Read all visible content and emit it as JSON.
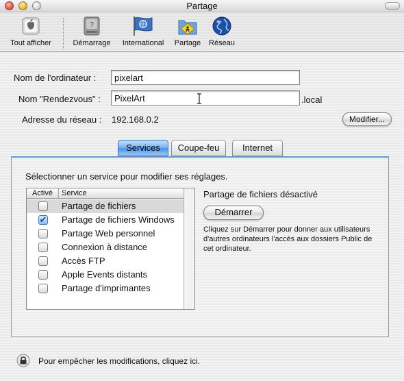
{
  "window": {
    "title": "Partage",
    "colors": {
      "close": "#e05a4c",
      "minimize": "#e9b73c",
      "zoom": "#d4d4d4",
      "accent": "#4f93e5"
    }
  },
  "toolbar": {
    "items": [
      {
        "label": "Tout afficher",
        "icon": "apple-logo-icon"
      },
      {
        "label": "Démarrage",
        "icon": "hard-drive-icon"
      },
      {
        "label": "International",
        "icon": "un-flag-icon"
      },
      {
        "label": "Partage",
        "icon": "shared-folder-icon"
      },
      {
        "label": "Réseau",
        "icon": "globe-icon"
      }
    ]
  },
  "identity": {
    "computer_name_label": "Nom de l'ordinateur :",
    "computer_name_value": "pixelart",
    "rendezvous_label": "Nom \"Rendezvous\" :",
    "rendezvous_value": "PixelArt",
    "rendezvous_suffix": ".local",
    "address_label": "Adresse du réseau :",
    "address_value": "192.168.0.2",
    "modify_button": "Modifier..."
  },
  "tabs": [
    {
      "label": "Services",
      "active": true
    },
    {
      "label": "Coupe-feu",
      "active": false
    },
    {
      "label": "Internet",
      "active": false
    }
  ],
  "services": {
    "instruction": "Sélectionner un service pour modifier ses réglages.",
    "col_active": "Activé",
    "col_service": "Service",
    "items": [
      {
        "name": "Partage de fichiers",
        "checked": false,
        "selected": true
      },
      {
        "name": "Partage de fichiers Windows",
        "checked": true,
        "selected": false
      },
      {
        "name": "Partage Web personnel",
        "checked": false,
        "selected": false
      },
      {
        "name": "Connexion à distance",
        "checked": false,
        "selected": false
      },
      {
        "name": "Accès FTP",
        "checked": false,
        "selected": false
      },
      {
        "name": "Apple Events distants",
        "checked": false,
        "selected": false
      },
      {
        "name": "Partage d'imprimantes",
        "checked": false,
        "selected": false
      }
    ],
    "status_title": "Partage de fichiers désactivé",
    "start_button": "Démarrer",
    "help_text": "Cliquez sur Démarrer pour donner aux utilisateurs d'autres ordinateurs l'accès aux dossiers Public de cet ordinateur."
  },
  "lock": {
    "text": "Pour empêcher les modifications, cliquez ici.",
    "icon": "lock-icon"
  }
}
